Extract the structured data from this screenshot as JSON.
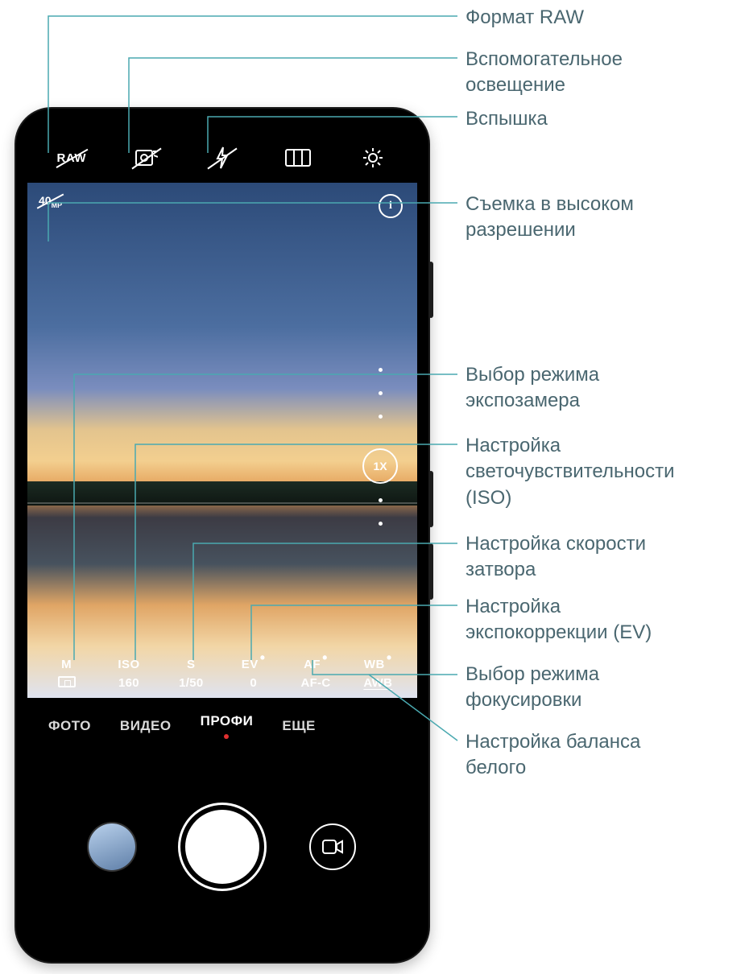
{
  "topbar": {
    "raw_label": "RAW",
    "icons": {
      "raw": "raw-format",
      "aux_light": "auxiliary-light-off",
      "flash": "flash-off",
      "aspect": "aspect-ratio",
      "settings": "settings"
    }
  },
  "viewfinder": {
    "hires_label": "40",
    "hires_suffix": "MP",
    "info_icon": "i",
    "zoom": "1X"
  },
  "params": [
    {
      "label": "M",
      "value_type": "metering",
      "value": ""
    },
    {
      "label": "ISO",
      "value": "160"
    },
    {
      "label": "S",
      "value": "1/50"
    },
    {
      "label": "EV",
      "value": "0",
      "dot": true
    },
    {
      "label": "AF",
      "value": "AF-C",
      "dot": true
    },
    {
      "label": "WB",
      "value": "AWB",
      "dot": true,
      "underline": true
    }
  ],
  "modes": {
    "items": [
      "ФОТО",
      "ВИДЕО",
      "ПРОФИ",
      "ЕЩЕ"
    ],
    "active_index": 2
  },
  "callouts": {
    "raw": "Формат RAW",
    "aux_light": "Вспомогательное\nосвещение",
    "flash": "Вспышка",
    "hires": "Съемка в высоком\nразрешении",
    "metering": "Выбор режима\nэкспозамера",
    "iso": "Настройка\nсветочувствительности\n(ISO)",
    "shutter": "Настройка скорости\nзатвора",
    "ev": "Настройка\nэкспокоррекции (EV)",
    "focus": "Выбор режима\nфокусировки",
    "wb": "Настройка баланса\nбелого"
  }
}
